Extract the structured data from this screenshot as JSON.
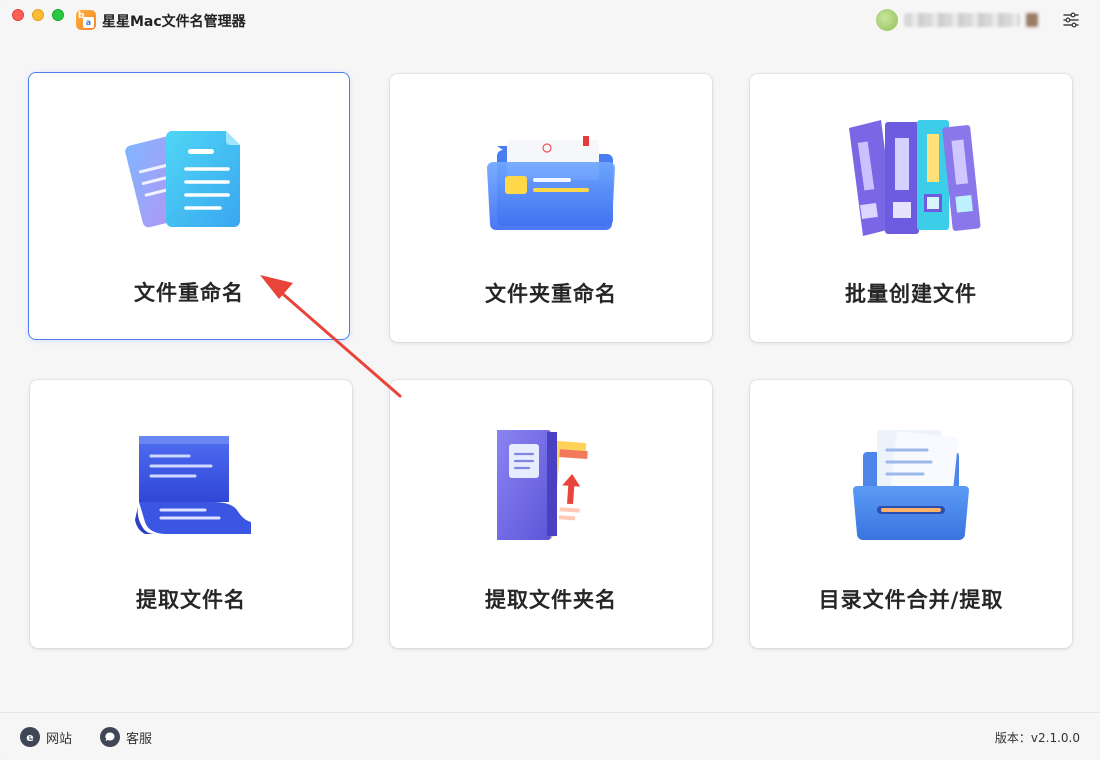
{
  "window": {
    "title": "星星Mac文件名管理器",
    "colors": {
      "accent": "#4f7ef2",
      "annotation_arrow": "#e8443a"
    }
  },
  "cards": [
    {
      "label": "文件重命名",
      "icon": "file-rename-icon",
      "selected": true
    },
    {
      "label": "文件夹重命名",
      "icon": "folder-rename-icon",
      "selected": false
    },
    {
      "label": "批量创建文件",
      "icon": "batch-create-icon",
      "selected": false
    },
    {
      "label": "提取文件名",
      "icon": "extract-filename-icon",
      "selected": false
    },
    {
      "label": "提取文件夹名",
      "icon": "extract-foldername-icon",
      "selected": false
    },
    {
      "label": "目录文件合并/提取",
      "icon": "directory-merge-icon",
      "selected": false
    }
  ],
  "footer": {
    "website_label": "网站",
    "support_label": "客服",
    "version_text": "版本：v2.1.0.0"
  }
}
